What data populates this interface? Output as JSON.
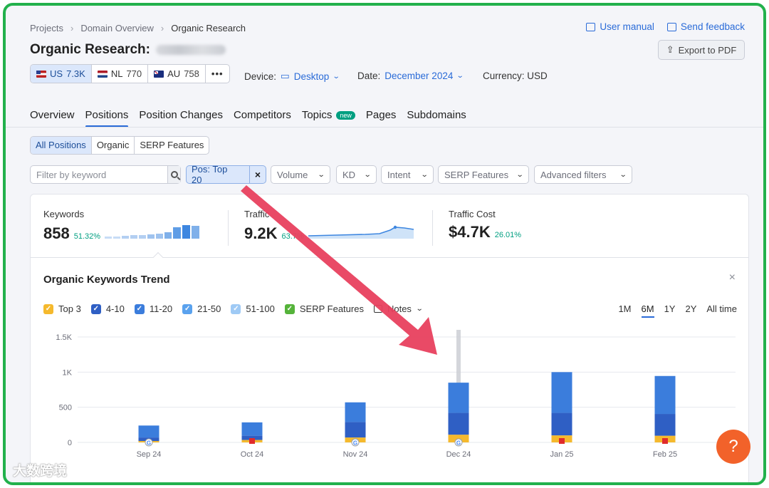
{
  "breadcrumb": [
    "Projects",
    "Domain Overview",
    "Organic Research"
  ],
  "top_links": {
    "user_manual": "User manual",
    "send_feedback": "Send feedback",
    "export_pdf": "Export to PDF"
  },
  "title": "Organic Research:",
  "databases": [
    {
      "code": "US",
      "count": "7.3K",
      "flag": "flag-us",
      "selected": true
    },
    {
      "code": "NL",
      "count": "770",
      "flag": "flag-nl",
      "selected": false
    },
    {
      "code": "AU",
      "count": "758",
      "flag": "flag-au",
      "selected": false
    }
  ],
  "more_label": "•••",
  "filters": {
    "device_label": "Device:",
    "device_value": "Desktop",
    "date_label": "Date:",
    "date_value": "December 2024",
    "currency": "Currency: USD"
  },
  "nav_tabs": [
    {
      "label": "Overview",
      "active": false
    },
    {
      "label": "Positions",
      "active": true
    },
    {
      "label": "Position Changes",
      "active": false
    },
    {
      "label": "Competitors",
      "active": false
    },
    {
      "label": "Topics",
      "active": false,
      "badge": "new"
    },
    {
      "label": "Pages",
      "active": false
    },
    {
      "label": "Subdomains",
      "active": false
    }
  ],
  "sub_tabs": [
    {
      "label": "All Positions",
      "selected": true
    },
    {
      "label": "Organic",
      "selected": false
    },
    {
      "label": "SERP Features",
      "selected": false
    }
  ],
  "search": {
    "placeholder": "Filter by keyword"
  },
  "filter_chips": {
    "active": "Pos: Top 20",
    "volume": "Volume",
    "kd": "KD",
    "intent": "Intent",
    "serp": "SERP Features",
    "advanced": "Advanced filters"
  },
  "metrics": {
    "keywords": {
      "label": "Keywords",
      "value": "858",
      "change": "51.32%"
    },
    "traffic": {
      "label": "Traffic",
      "value": "9.2K",
      "change": "63.7%"
    },
    "cost": {
      "label": "Traffic Cost",
      "value": "$4.7K",
      "change": "26.01%"
    }
  },
  "trend": {
    "title": "Organic Keywords Trend",
    "close": "×",
    "legend": [
      {
        "label": "Top 3",
        "color": "#f5b92d"
      },
      {
        "label": "4-10",
        "color": "#2f5fc4"
      },
      {
        "label": "11-20",
        "color": "#3b7ddc"
      },
      {
        "label": "21-50",
        "color": "#5aa2ee"
      },
      {
        "label": "51-100",
        "color": "#9fcaf5"
      },
      {
        "label": "SERP Features",
        "color": "#55b33a"
      }
    ],
    "notes_label": "Notes",
    "periods": [
      {
        "label": "1M",
        "selected": false
      },
      {
        "label": "6M",
        "selected": true
      },
      {
        "label": "1Y",
        "selected": false
      },
      {
        "label": "2Y",
        "selected": false
      },
      {
        "label": "All time",
        "selected": false
      }
    ]
  },
  "chart_data": {
    "type": "bar",
    "stacked": true,
    "categories": [
      "Sep 24",
      "Oct 24",
      "Nov 24",
      "Dec 24",
      "Jan 25",
      "Feb 25"
    ],
    "ylim": [
      0,
      1500
    ],
    "yticks": [
      0,
      500,
      1000,
      1500
    ],
    "ytick_labels": [
      "0",
      "500",
      "1K",
      "1.5K"
    ],
    "series": [
      {
        "name": "Top 3",
        "color": "#f5b92d",
        "values": [
          20,
          35,
          70,
          110,
          100,
          95
        ]
      },
      {
        "name": "4-10",
        "color": "#2f5fc4",
        "values": [
          50,
          60,
          220,
          310,
          320,
          310
        ]
      },
      {
        "name": "11-20",
        "color": "#3b7ddc",
        "values": [
          170,
          190,
          280,
          430,
          580,
          540
        ]
      }
    ],
    "markers": [
      "google",
      "flag",
      "google",
      "google",
      "flag",
      "flag"
    ],
    "highlight_category": "Dec 24",
    "grid": true
  },
  "colors": {
    "accent": "#2a6bd8",
    "green": "#009f81",
    "border": "#22b14c",
    "help": "#f2622a",
    "arrow": "#e8405e"
  },
  "help_label": "?",
  "watermark": "大数跨境"
}
